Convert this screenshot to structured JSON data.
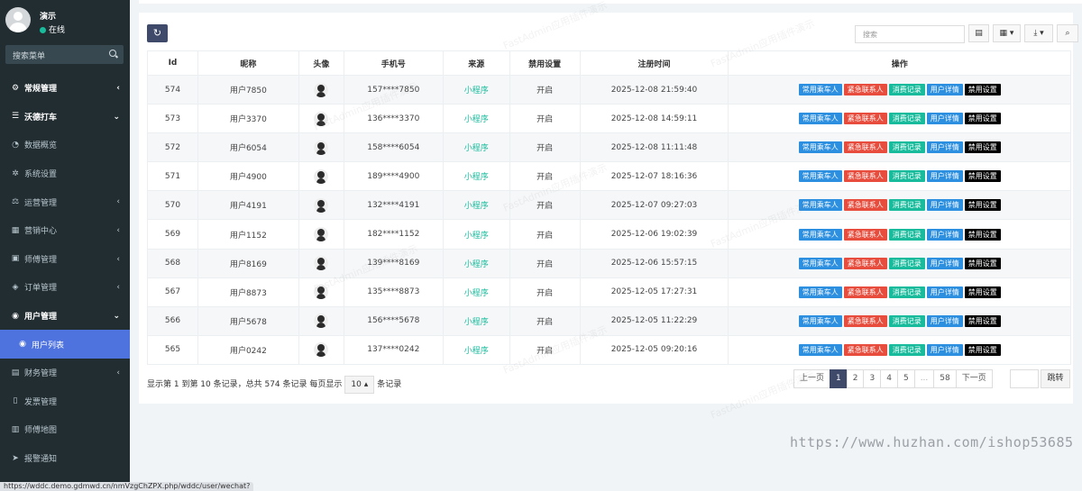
{
  "user": {
    "name": "演示",
    "status": "在线"
  },
  "menu_search_placeholder": "搜索菜单",
  "menu": [
    {
      "label": "常规管理",
      "icon": "gears-icon",
      "glyph": "⚙",
      "arrow": "‹",
      "type": "top"
    },
    {
      "label": "沃德打车",
      "icon": "list-icon",
      "glyph": "☰",
      "arrow": "⌄",
      "type": "top"
    },
    {
      "label": "数据概览",
      "icon": "dashboard-icon",
      "glyph": "◔",
      "arrow": "",
      "type": "sub"
    },
    {
      "label": "系统设置",
      "icon": "gear-icon",
      "glyph": "✲",
      "arrow": "",
      "type": "sub"
    },
    {
      "label": "运营管理",
      "icon": "balance-icon",
      "glyph": "⚖",
      "arrow": "‹",
      "type": "sub"
    },
    {
      "label": "营销中心",
      "icon": "calendar-icon",
      "glyph": "▦",
      "arrow": "‹",
      "type": "sub"
    },
    {
      "label": "师傅管理",
      "icon": "id-card-icon",
      "glyph": "▣",
      "arrow": "‹",
      "type": "sub"
    },
    {
      "label": "订单管理",
      "icon": "cube-icon",
      "glyph": "◈",
      "arrow": "‹",
      "type": "sub"
    },
    {
      "label": "用户管理",
      "icon": "user-circle-icon",
      "glyph": "◉",
      "arrow": "⌄",
      "type": "top"
    },
    {
      "label": "用户列表",
      "icon": "user-circle-icon",
      "glyph": "◉",
      "arrow": "",
      "type": "active"
    },
    {
      "label": "财务管理",
      "icon": "money-icon",
      "glyph": "▤",
      "arrow": "‹",
      "type": "sub"
    },
    {
      "label": "发票管理",
      "icon": "file-icon",
      "glyph": "▯",
      "arrow": "",
      "type": "sub"
    },
    {
      "label": "师傅地图",
      "icon": "map-icon",
      "glyph": "▥",
      "arrow": "",
      "type": "sub"
    },
    {
      "label": "报警通知",
      "icon": "send-icon",
      "glyph": "➤",
      "arrow": "",
      "type": "sub"
    }
  ],
  "status_url": "https://wddc.demo.gdmwd.cn/nmVzgChZPX.php/wddc/user/wechat?ref=addtabs",
  "toolbar": {
    "refresh_glyph": "↻",
    "search_placeholder": "搜索"
  },
  "table": {
    "headers": [
      "Id",
      "昵称",
      "头像",
      "手机号",
      "来源",
      "禁用设置",
      "注册时间",
      "操作"
    ],
    "actions": [
      "常用乘车人",
      "紧急联系人",
      "消费记录",
      "用户详情",
      "禁用设置"
    ],
    "rows": [
      {
        "id": "574",
        "nick": "用户7850",
        "phone": "157****7850",
        "source": "小程序",
        "ban": "开启",
        "time": "2025-12-08 21:59:40"
      },
      {
        "id": "573",
        "nick": "用户3370",
        "phone": "136****3370",
        "source": "小程序",
        "ban": "开启",
        "time": "2025-12-08 14:59:11"
      },
      {
        "id": "572",
        "nick": "用户6054",
        "phone": "158****6054",
        "source": "小程序",
        "ban": "开启",
        "time": "2025-12-08 11:11:48"
      },
      {
        "id": "571",
        "nick": "用户4900",
        "phone": "189****4900",
        "source": "小程序",
        "ban": "开启",
        "time": "2025-12-07 18:16:36"
      },
      {
        "id": "570",
        "nick": "用户4191",
        "phone": "132****4191",
        "source": "小程序",
        "ban": "开启",
        "time": "2025-12-07 09:27:03"
      },
      {
        "id": "569",
        "nick": "用户1152",
        "phone": "182****1152",
        "source": "小程序",
        "ban": "开启",
        "time": "2025-12-06 19:02:39"
      },
      {
        "id": "568",
        "nick": "用户8169",
        "phone": "139****8169",
        "source": "小程序",
        "ban": "开启",
        "time": "2025-12-06 15:57:15"
      },
      {
        "id": "567",
        "nick": "用户8873",
        "phone": "135****8873",
        "source": "小程序",
        "ban": "开启",
        "time": "2025-12-05 17:27:31"
      },
      {
        "id": "566",
        "nick": "用户5678",
        "phone": "156****5678",
        "source": "小程序",
        "ban": "开启",
        "time": "2025-12-05 11:22:29"
      },
      {
        "id": "565",
        "nick": "用户0242",
        "phone": "137****0242",
        "source": "小程序",
        "ban": "开启",
        "time": "2025-12-05 09:20:16"
      }
    ]
  },
  "pagination": {
    "info_prefix": "显示第 1 到第 10 条记录，总共 574 条记录 每页显示",
    "page_size": "10",
    "info_suffix": "条记录",
    "prev": "上一页",
    "pages": [
      "1",
      "2",
      "3",
      "4",
      "5",
      "...",
      "58"
    ],
    "active_page": "1",
    "next": "下一页",
    "jump": "跳转"
  },
  "watermark_text": "FastAdmin应用插件演示",
  "shop_watermark": "https://www.huzhan.com/ishop53685"
}
